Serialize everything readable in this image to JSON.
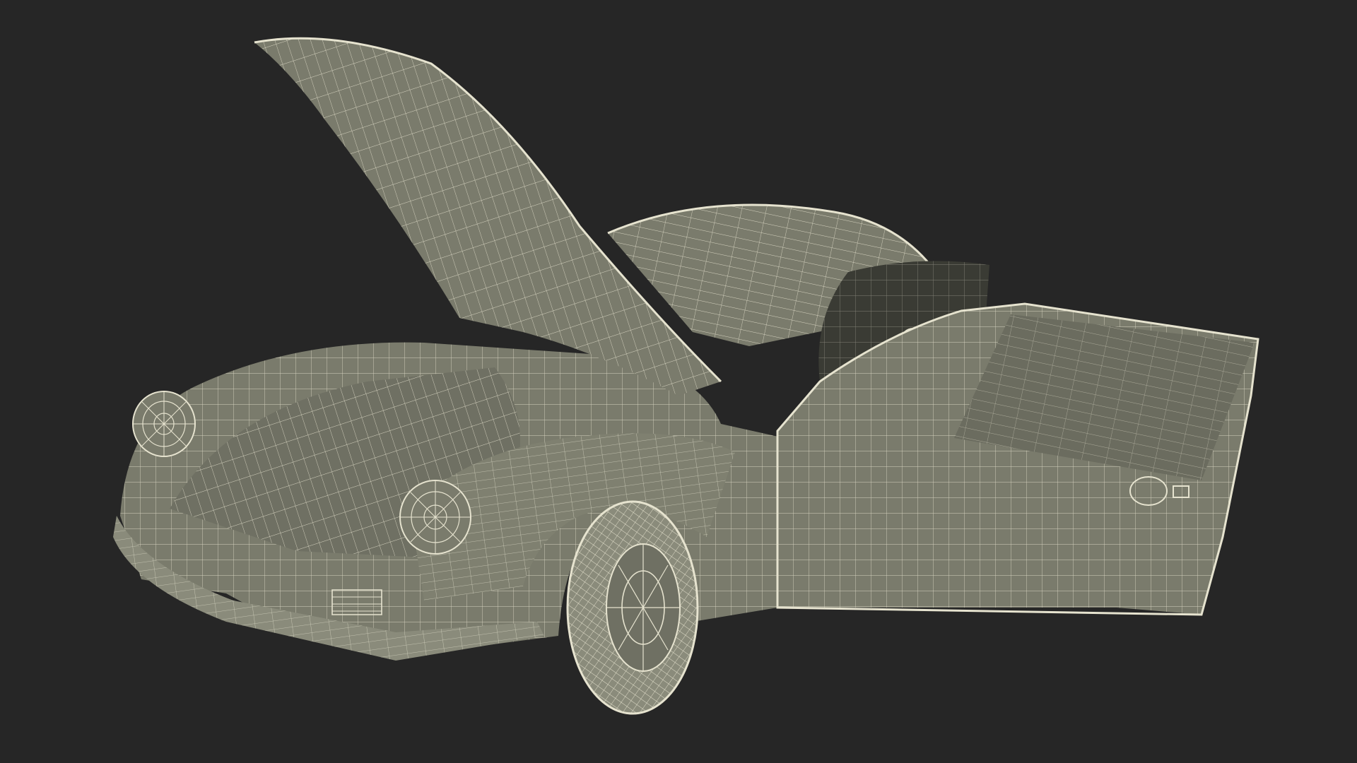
{
  "scene": {
    "background_color": "#262626",
    "body_fill": "#7a7b6c",
    "shadow_fill": "#5f6055",
    "wire_color": "#e6e3cf",
    "interior_fill": "#3a3b34",
    "subject": "wireframe-car-model"
  }
}
